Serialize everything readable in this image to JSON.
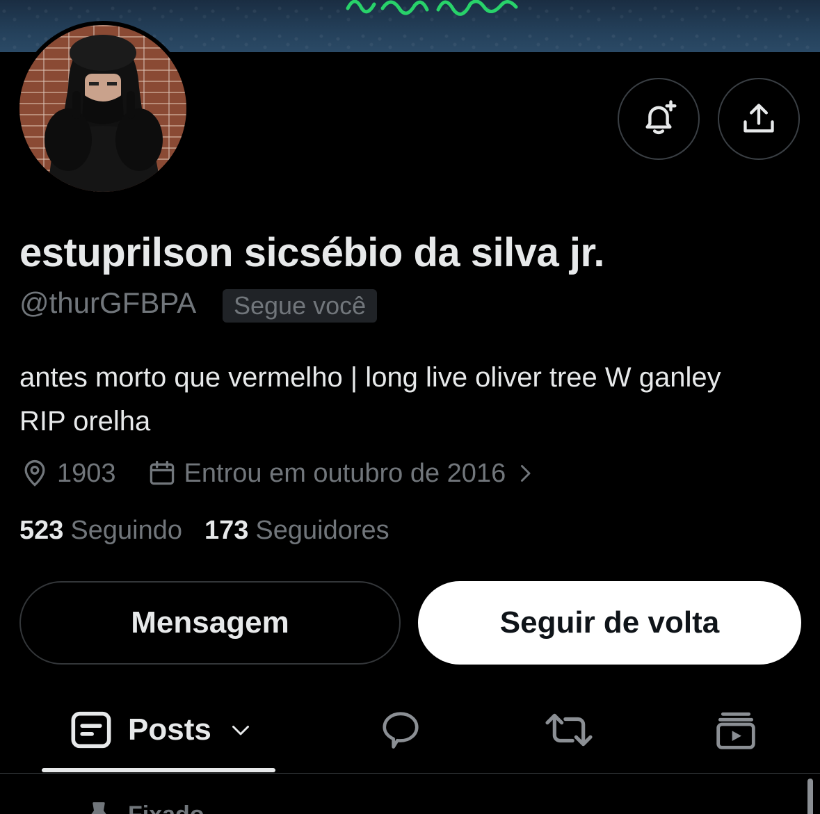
{
  "banner": {
    "text_color": "#28d26a"
  },
  "profile": {
    "display_name": "estuprilson sicsébio da silva jr.",
    "handle": "@thurGFBPA",
    "follows_you_badge": "Segue você",
    "bio_line1": "antes morto que vermelho | long live oliver tree W ganley",
    "bio_line2": "RIP orelha",
    "location": "1903",
    "joined": "Entrou em outubro de 2016",
    "following_count": "523",
    "following_label": "Seguindo",
    "followers_count": "173",
    "followers_label": "Seguidores"
  },
  "actions": {
    "notifications_icon": "bell-plus-icon",
    "share_icon": "share-icon",
    "message_label": "Mensagem",
    "follow_back_label": "Seguir de volta"
  },
  "tabs": {
    "posts_label": "Posts",
    "posts_icon": "posts-icon",
    "replies_icon": "reply-bubble-icon",
    "reposts_icon": "repost-icon",
    "media_icon": "media-icon",
    "active": "Posts"
  },
  "pinned": {
    "label": "Fixado"
  },
  "colors": {
    "background": "#000000",
    "primary_text": "#e7e9ea",
    "secondary_text": "#71767b",
    "border": "#333639"
  }
}
